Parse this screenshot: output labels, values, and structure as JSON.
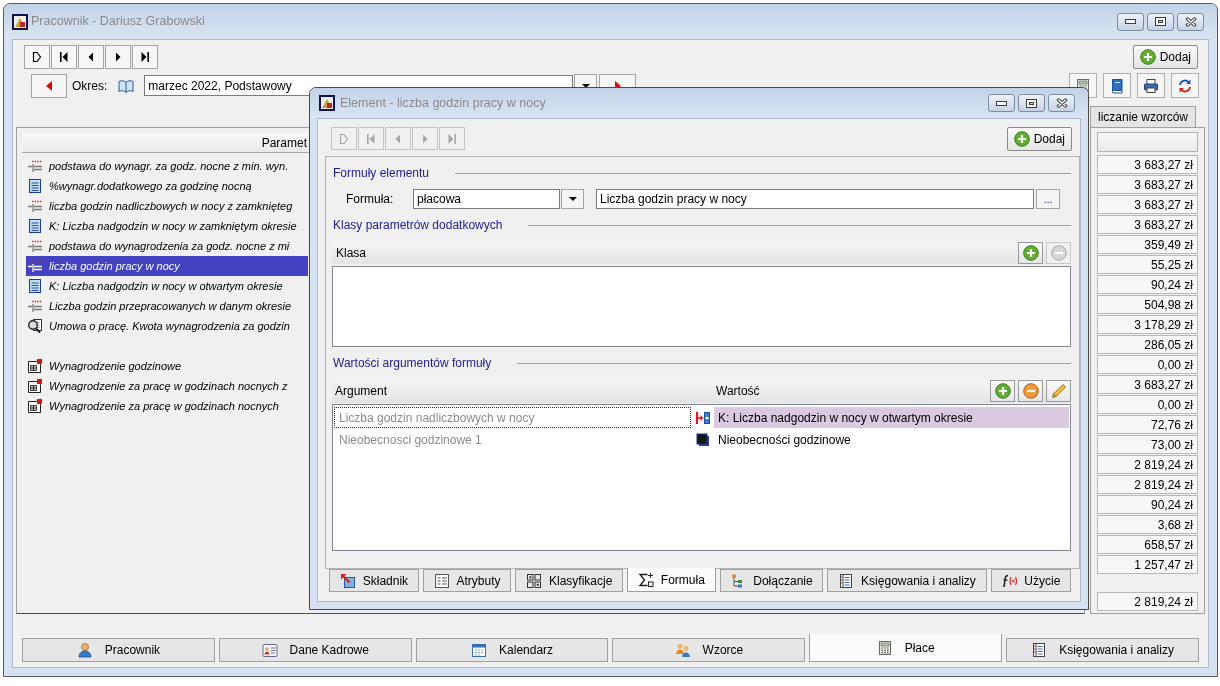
{
  "main_window": {
    "title": "Pracownik - Dariusz Grabowski",
    "navigator": {
      "disabled": false
    },
    "add_button": "Dodaj",
    "period": {
      "label": "Okres:",
      "value": "marzec 2022, Podstawowy"
    },
    "parameters": {
      "header": "Paramet",
      "groups": [
        {
          "items": [
            {
              "label": "podstawa do wynagr. za godz. nocne z min. wyn.",
              "kind": "dashed",
              "selected": false
            },
            {
              "label": "%wynagr.dodatkowego za godzinę nocną",
              "kind": "sheet",
              "selected": false
            },
            {
              "label": "liczba godzin nadliczbowych w nocy z zamknięteg",
              "kind": "dashed",
              "selected": false
            },
            {
              "label": "K: Liczba nadgodzin w nocy w zamkniętym okresie",
              "kind": "sheet",
              "selected": false
            },
            {
              "label": "podstawa do wynagrodzenia za godz. nocne z mi",
              "kind": "dashed",
              "selected": false
            },
            {
              "label": "liczba godzin pracy w nocy",
              "kind": "dashed",
              "selected": true
            },
            {
              "label": "K: Liczba nadgodzin w nocy w otwartym okresie",
              "kind": "sheet",
              "selected": false
            },
            {
              "label": "Liczba godzin przepracowanych w danym okresie",
              "kind": "dashed",
              "selected": false
            },
            {
              "label": "Umowa o pracę. Kwota wynagrodzenia za godzin",
              "kind": "magnifier",
              "selected": false
            }
          ]
        },
        {
          "items": [
            {
              "label": "Wynagrodzenie godzinowe",
              "kind": "document",
              "selected": false
            },
            {
              "label": "Wynagrodzenie za pracę w godzinach nocnych z",
              "kind": "document",
              "selected": false
            },
            {
              "label": "Wynagrodzenie za pracę w godzinach nocnych",
              "kind": "document",
              "selected": false
            }
          ]
        }
      ]
    },
    "side_tab": {
      "label": "liczanie wzorców",
      "selected": false
    },
    "amounts": {
      "rows": [
        "3 683,27 zł",
        "3 683,27 zł",
        "3 683,27 zł",
        "3 683,27 zł",
        "359,49 zł",
        "55,25 zł",
        "90,24 zł",
        "504,98 zł",
        "3 178,29 zł",
        "286,05 zł",
        "0,00 zł",
        "3 683,27 zł",
        "0,00 zł",
        "72,76 zł",
        "73,00 zł",
        "2 819,24 zł",
        "2 819,24 zł",
        "90,24 zł",
        "3,68 zł",
        "658,57 zł",
        "1 257,47 zł"
      ],
      "total": "2 819,24 zł"
    },
    "tabs": [
      {
        "label": "Pracownik",
        "selected": false
      },
      {
        "label": "Dane Kadrowe",
        "selected": false
      },
      {
        "label": "Kalendarz",
        "selected": false
      },
      {
        "label": "Wzorce",
        "selected": false
      },
      {
        "label": "Płace",
        "selected": true
      },
      {
        "label": "Księgowania i analizy",
        "selected": false
      }
    ]
  },
  "dialog": {
    "title": "Element - liczba godzin pracy w nocy",
    "navigator": {
      "disabled": true
    },
    "add_button": "Dodaj",
    "formula": {
      "heading": "Formuły elementu",
      "label": "Formuła:",
      "type_value": "płacowa",
      "name_value": "Liczba godzin pracy w nocy",
      "browse_button": "..."
    },
    "classes": {
      "heading": "Klasy parametrów dodatkowych",
      "columns": [
        "Klasa"
      ],
      "toolbar": [
        {
          "kind": "add",
          "disabled": false
        },
        {
          "kind": "remove",
          "disabled": true
        }
      ]
    },
    "arguments": {
      "heading": "Wartości argumentów formuły",
      "columns": [
        "Argument",
        "Wartość"
      ],
      "toolbar": [
        {
          "kind": "add",
          "disabled": false
        },
        {
          "kind": "remove",
          "disabled": false
        },
        {
          "kind": "edit",
          "disabled": false
        }
      ],
      "rows": [
        {
          "argument": "Liczba godzin nadliczbowych w nocy",
          "kind": "connector",
          "value": "K: Liczba nadgodzin w nocy w otwartym okresie",
          "selected": true
        },
        {
          "argument": "Nieobecnosci godzinowe 1",
          "kind": "square",
          "value": "Nieobecności godzinowe",
          "selected": false
        }
      ]
    },
    "tabs": [
      {
        "label": "Składnik",
        "selected": false
      },
      {
        "label": "Atrybuty",
        "selected": false
      },
      {
        "label": "Klasyfikacje",
        "selected": false
      },
      {
        "label": "Formuła",
        "selected": true
      },
      {
        "label": "Dołączanie",
        "selected": false
      },
      {
        "label": "Księgowania i analizy",
        "selected": false
      },
      {
        "label": "Użycie",
        "selected": false
      }
    ]
  }
}
